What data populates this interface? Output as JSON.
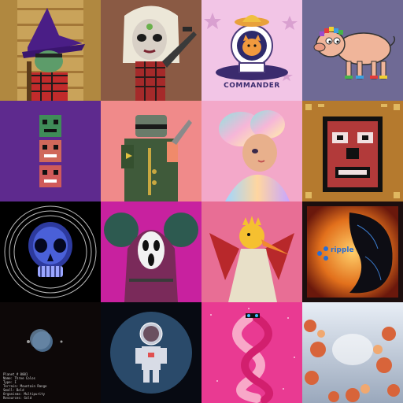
{
  "gallery": {
    "tiles": [
      {
        "name": "wizard-goblin",
        "bg": "#c9a35a"
      },
      {
        "name": "blonde-zombie-girl",
        "bg": "#8a5a44"
      },
      {
        "name": "astronaut-cat",
        "bg": "#f2c5e6",
        "caption": "COMMANDER"
      },
      {
        "name": "pig",
        "bg": "#6f6a95"
      },
      {
        "name": "pixel-skull-totem",
        "bg": "#5e2a8e"
      },
      {
        "name": "armored-soldier",
        "bg": "#f08a8a"
      },
      {
        "name": "pastel-anime-girl",
        "bg": "#f3a8c9"
      },
      {
        "name": "pixel-tiki-mask",
        "bg": "#b57a2e"
      },
      {
        "name": "chrome-skull",
        "bg": "#000000"
      },
      {
        "name": "hooded-scream-mask",
        "bg": "#c8219f"
      },
      {
        "name": "orange-bird-sage",
        "bg": "#e86e95"
      },
      {
        "name": "ripple-panther",
        "bg": "#1c0e0e",
        "caption": "ripple"
      },
      {
        "name": "space-planet",
        "bg": "#0d0808",
        "caption": "Planet # 0001\nName: Three Colos\nType: I\nTerrain: Mountain Range\nSmall: Bold\nOrganisms: Multipurity\nResources: Gold"
      },
      {
        "name": "astronaut-creature",
        "bg": "#070a12"
      },
      {
        "name": "sparkle-snakes",
        "bg": "#e93a92"
      },
      {
        "name": "coral-sky",
        "bg": "#c9d3df"
      }
    ]
  }
}
